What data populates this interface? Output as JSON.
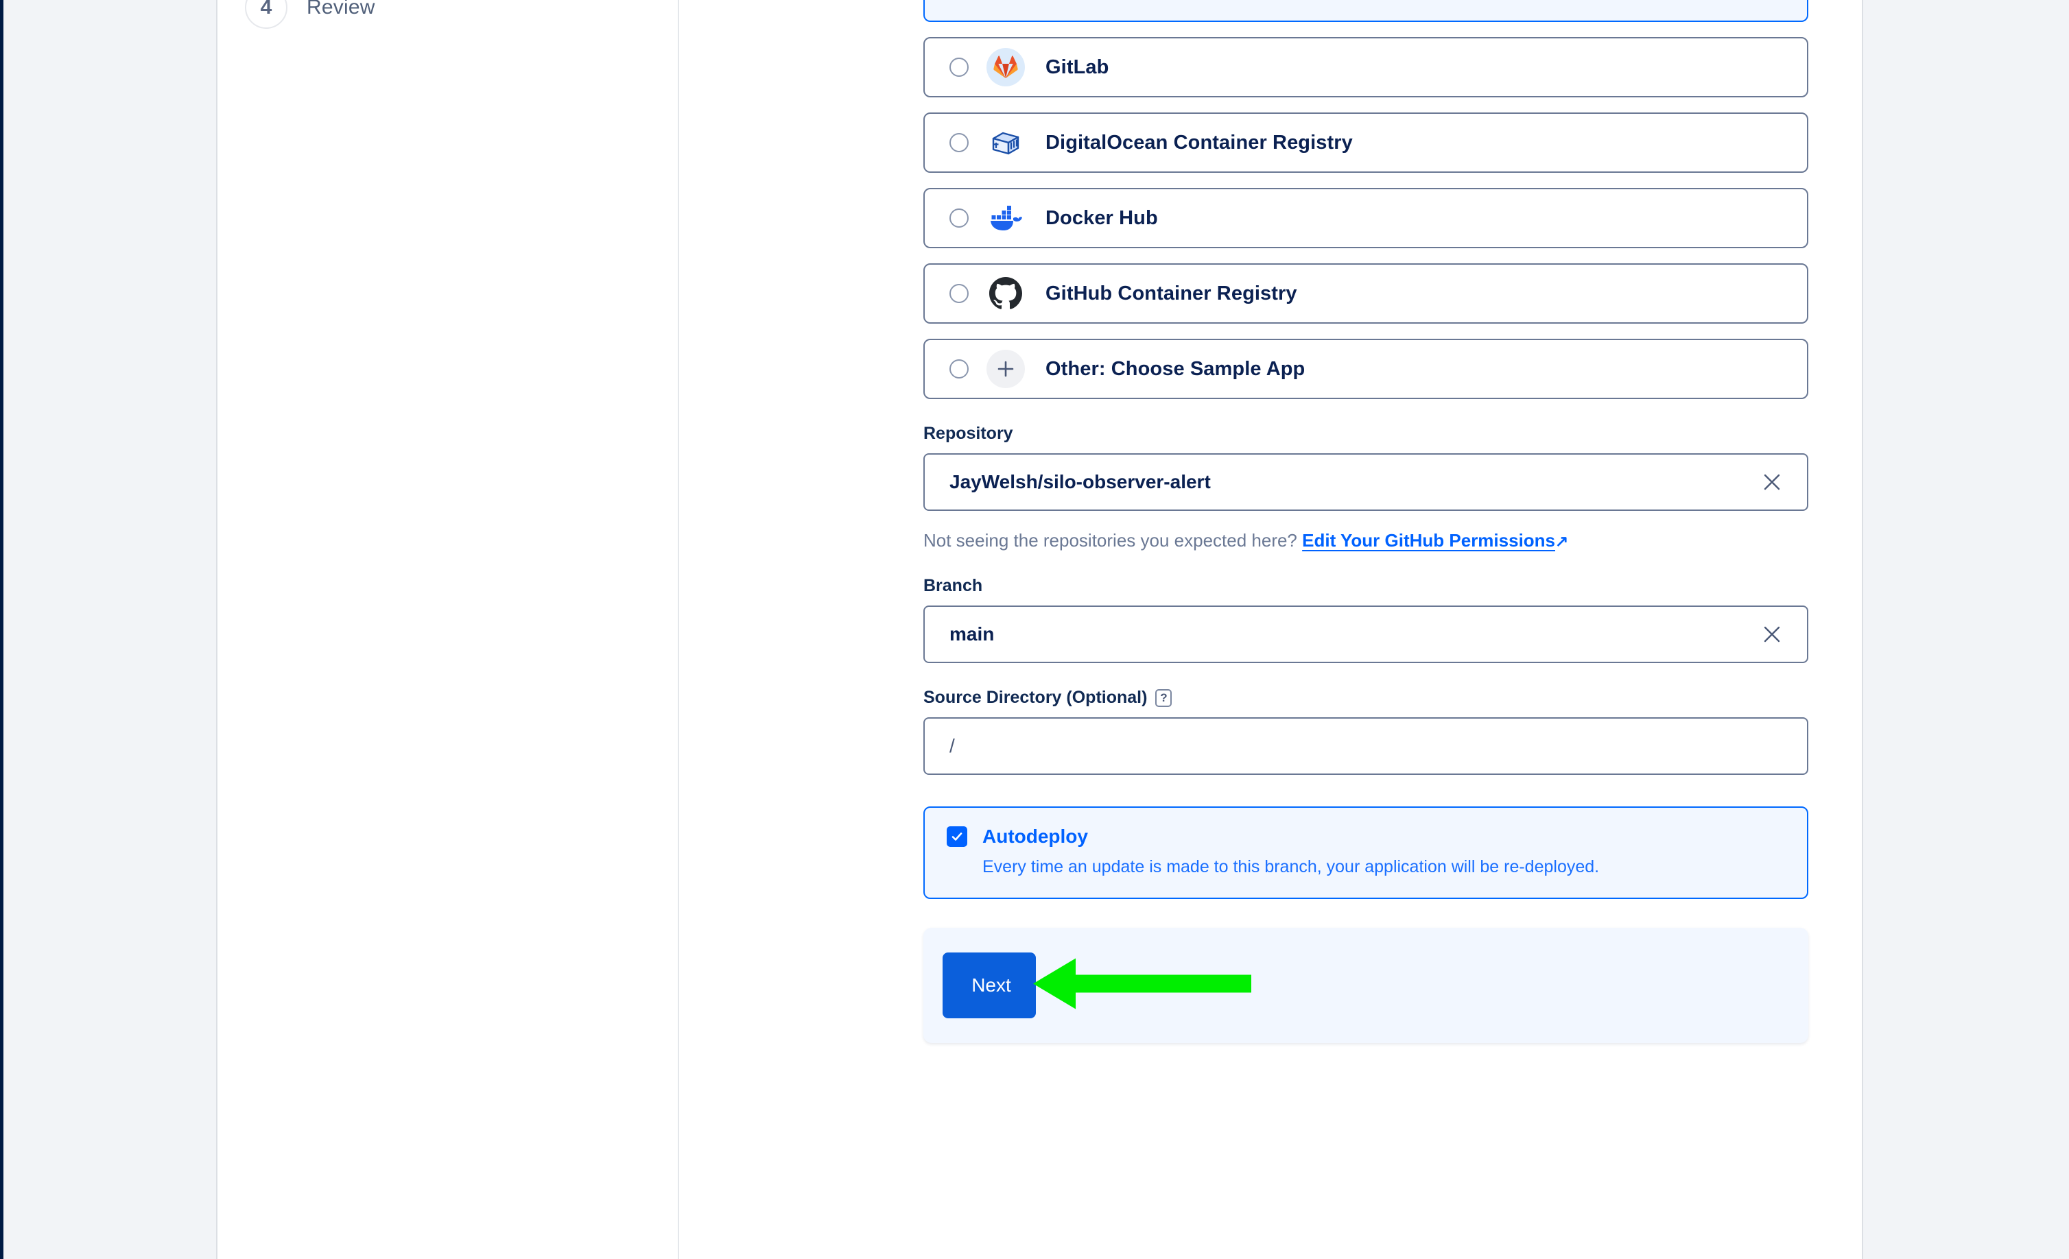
{
  "sidebar": {
    "steps": [
      {
        "number": "4",
        "label": "Review"
      }
    ]
  },
  "source_options": [
    {
      "id": "clipped-selected",
      "label": "",
      "icon": "selected-source-icon",
      "selected": true,
      "clipped": true
    },
    {
      "id": "gitlab",
      "label": "GitLab",
      "icon": "gitlab-icon",
      "selected": false,
      "clipped": false
    },
    {
      "id": "do-container-registry",
      "label": "DigitalOcean Container Registry",
      "icon": "digitalocean-container-icon",
      "selected": false,
      "clipped": false
    },
    {
      "id": "docker-hub",
      "label": "Docker Hub",
      "icon": "docker-icon",
      "selected": false,
      "clipped": false
    },
    {
      "id": "github-container-registry",
      "label": "GitHub Container Registry",
      "icon": "github-icon",
      "selected": false,
      "clipped": false
    },
    {
      "id": "other-sample-app",
      "label": "Other: Choose Sample App",
      "icon": "plus-icon",
      "selected": false,
      "clipped": false
    }
  ],
  "repository": {
    "label": "Repository",
    "value": "JayWelsh/silo-observer-alert",
    "clear_icon": "close-icon"
  },
  "permissions_hint": {
    "text": "Not seeing the repositories you expected here?",
    "link_text": "Edit Your GitHub Permissions",
    "external_icon": "external-link-icon"
  },
  "branch": {
    "label": "Branch",
    "value": "main",
    "clear_icon": "close-icon"
  },
  "source_directory": {
    "label": "Source Directory (Optional)",
    "help_icon": "?",
    "value": "/"
  },
  "autodeploy": {
    "title": "Autodeploy",
    "description": "Every time an update is made to this branch, your application will be re-deployed.",
    "checked": true,
    "check_icon": "check-icon"
  },
  "footer": {
    "next_label": "Next"
  },
  "annotation": {
    "type": "arrow-left",
    "color": "#00ee00",
    "points_at": "next-button"
  },
  "colors": {
    "accent_blue": "#0069ff",
    "button_blue": "#0b5fdb",
    "link_blue": "#0062ff",
    "border_slate": "#6a7894",
    "text_navy": "#0b2152",
    "panel_bg": "#ffffff",
    "page_bg": "#f2f4f7",
    "highlight_bg": "#f2f7ff",
    "annotation_green": "#00ee00"
  }
}
